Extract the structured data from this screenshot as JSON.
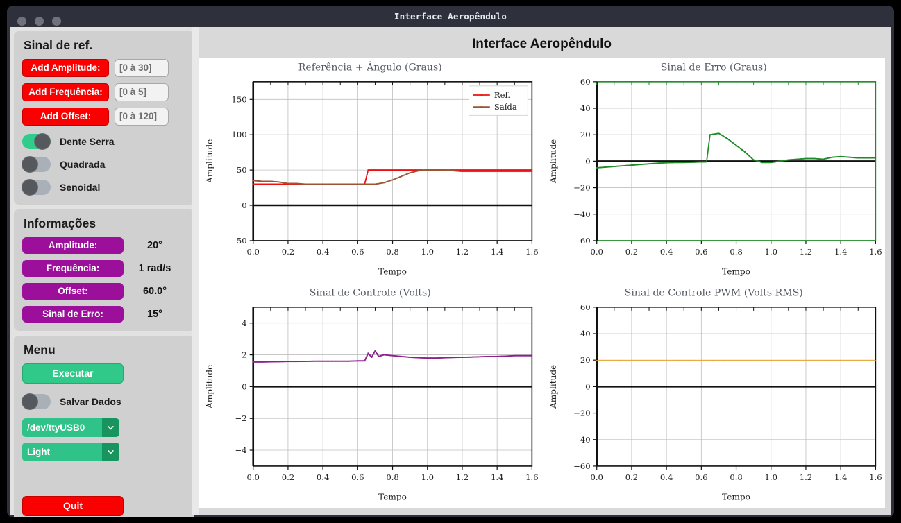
{
  "titlebar": {
    "title": "Interface Aeropêndulo"
  },
  "header": {
    "title": "Interface Aeropêndulo"
  },
  "sidebar": {
    "signal_panel": {
      "title": "Sinal de ref.",
      "inputs": [
        {
          "button": "Add Amplitude:",
          "placeholder": "[0 à 30]"
        },
        {
          "button": "Add Frequência:",
          "placeholder": "[0 à 5]"
        },
        {
          "button": "Add Offset:",
          "placeholder": "[0 à 120]"
        }
      ],
      "toggles": [
        {
          "label": "Dente Serra",
          "state": "on"
        },
        {
          "label": "Quadrada",
          "state": "off"
        },
        {
          "label": "Senoidal",
          "state": "off"
        }
      ]
    },
    "info_panel": {
      "title": "Informações",
      "rows": [
        {
          "label": "Amplitude:",
          "value": "20°"
        },
        {
          "label": "Frequência:",
          "value": "1 rad/s"
        },
        {
          "label": "Offset:",
          "value": "60.0°"
        },
        {
          "label": "Sinal de Erro:",
          "value": "15°"
        }
      ]
    },
    "menu_panel": {
      "title": "Menu",
      "run_label": "Executar",
      "save_toggle": {
        "label": "Salvar Dados",
        "state": "off"
      },
      "port_select": {
        "value": "/dev/ttyUSB0"
      },
      "theme_select": {
        "value": "Light"
      },
      "quit_label": "Quit"
    }
  },
  "colors": {
    "red": "#fa0000",
    "purple": "#9b0f9b",
    "green": "#31c98a",
    "toggle_on": "#2fcc8b",
    "ref_line": "#ee1111",
    "saida_line": "#9c5434",
    "erro_line": "#1d8b28",
    "controle_line": "#8e2090",
    "pwm_line": "#f2a621"
  },
  "chart_data": [
    {
      "type": "line",
      "title": "Referência + Ângulo (Graus)",
      "xlabel": "Tempo",
      "ylabel": "Amplitude",
      "xlim": [
        0.0,
        1.6
      ],
      "ylim": [
        -50,
        175
      ],
      "xticks": [
        "0.0",
        "0.2",
        "0.4",
        "0.6",
        "0.8",
        "1.0",
        "1.2",
        "1.4",
        "1.6"
      ],
      "yticks": [
        "−50",
        "0",
        "50",
        "100",
        "150"
      ],
      "ytick_values": [
        -50,
        0,
        50,
        100,
        150
      ],
      "grid": true,
      "legend": [
        "Ref.",
        "Saída"
      ],
      "legend_position": "upper right",
      "x": [
        0.0,
        0.05,
        0.1,
        0.15,
        0.2,
        0.25,
        0.3,
        0.35,
        0.4,
        0.45,
        0.5,
        0.55,
        0.6,
        0.64,
        0.66,
        0.7,
        0.75,
        0.8,
        0.85,
        0.9,
        0.95,
        1.0,
        1.05,
        1.1,
        1.15,
        1.2,
        1.25,
        1.3,
        1.35,
        1.4,
        1.45,
        1.5,
        1.55,
        1.6
      ],
      "series": [
        {
          "name": "Ref.",
          "color": "#ee1111",
          "values": [
            30,
            30,
            30,
            30,
            30,
            30,
            30,
            30,
            30,
            30,
            30,
            30,
            30,
            30,
            50,
            50,
            50,
            50,
            50,
            50,
            50,
            50,
            50,
            50,
            50,
            50,
            50,
            50,
            50,
            50,
            50,
            50,
            50,
            50
          ]
        },
        {
          "name": "Saída",
          "color": "#9c5434",
          "values": [
            35,
            34,
            34,
            33,
            31,
            31,
            30,
            30,
            30,
            30,
            30,
            30,
            30,
            30,
            30,
            30,
            32,
            36,
            41,
            46,
            49,
            50,
            50,
            50,
            49,
            48,
            48,
            48,
            48,
            48,
            48,
            48,
            48,
            48
          ]
        }
      ]
    },
    {
      "type": "line",
      "title": "Sinal de Erro (Graus)",
      "xlabel": "Tempo",
      "ylabel": "Amplitude",
      "xlim": [
        0.0,
        1.6
      ],
      "ylim": [
        -60,
        60
      ],
      "xticks": [
        "0.0",
        "0.2",
        "0.4",
        "0.6",
        "0.8",
        "1.0",
        "1.2",
        "1.4",
        "1.6"
      ],
      "yticks": [
        "−60",
        "−40",
        "−20",
        "0",
        "20",
        "40",
        "60"
      ],
      "ytick_values": [
        -60,
        -40,
        -20,
        0,
        20,
        40,
        60
      ],
      "grid": true,
      "spine_color": "#1d8b28",
      "x": [
        0.0,
        0.05,
        0.1,
        0.15,
        0.2,
        0.25,
        0.3,
        0.35,
        0.4,
        0.45,
        0.5,
        0.55,
        0.6,
        0.63,
        0.65,
        0.7,
        0.75,
        0.8,
        0.85,
        0.9,
        0.95,
        1.0,
        1.05,
        1.1,
        1.15,
        1.2,
        1.25,
        1.3,
        1.35,
        1.4,
        1.45,
        1.5,
        1.55,
        1.6
      ],
      "series": [
        {
          "name": "Erro",
          "color": "#1d8b28",
          "values": [
            -5,
            -4.5,
            -4,
            -3.5,
            -3,
            -2.5,
            -2,
            -1.5,
            -1.2,
            -1,
            -1,
            -0.8,
            -0.6,
            -0.5,
            20,
            21,
            17,
            12,
            7,
            1,
            -1,
            -1,
            0,
            1,
            1.5,
            2,
            2,
            1.5,
            3,
            3.5,
            3,
            2.5,
            2.5,
            2.5
          ]
        }
      ]
    },
    {
      "type": "line",
      "title": "Sinal de Controle (Volts)",
      "xlabel": "Tempo",
      "ylabel": "Amplitude",
      "xlim": [
        0.0,
        1.6
      ],
      "ylim": [
        -5,
        5
      ],
      "xticks": [
        "0.0",
        "0.2",
        "0.4",
        "0.6",
        "0.8",
        "1.0",
        "1.2",
        "1.4",
        "1.6"
      ],
      "yticks": [
        "−4",
        "−2",
        "0",
        "2",
        "4"
      ],
      "ytick_values": [
        -4,
        -2,
        0,
        2,
        4
      ],
      "grid": true,
      "x": [
        0.0,
        0.05,
        0.1,
        0.15,
        0.2,
        0.25,
        0.3,
        0.35,
        0.4,
        0.45,
        0.5,
        0.55,
        0.6,
        0.64,
        0.66,
        0.68,
        0.7,
        0.72,
        0.75,
        0.8,
        0.85,
        0.9,
        0.95,
        1.0,
        1.05,
        1.1,
        1.15,
        1.2,
        1.25,
        1.3,
        1.35,
        1.4,
        1.45,
        1.5,
        1.55,
        1.6
      ],
      "series": [
        {
          "name": "Controle",
          "color": "#8e2090",
          "values": [
            1.55,
            1.55,
            1.56,
            1.57,
            1.58,
            1.58,
            1.59,
            1.6,
            1.6,
            1.6,
            1.6,
            1.6,
            1.62,
            1.62,
            2.1,
            1.85,
            2.25,
            1.9,
            2.0,
            1.95,
            1.9,
            1.85,
            1.82,
            1.8,
            1.8,
            1.82,
            1.84,
            1.85,
            1.86,
            1.88,
            1.9,
            1.9,
            1.92,
            1.95,
            1.95,
            1.95
          ]
        }
      ]
    },
    {
      "type": "line",
      "title": "Sinal de Controle PWM (Volts RMS)",
      "xlabel": "Tempo",
      "ylabel": "Amplitude",
      "xlim": [
        0.0,
        1.6
      ],
      "ylim": [
        -60,
        60
      ],
      "xticks": [
        "0.0",
        "0.2",
        "0.4",
        "0.6",
        "0.8",
        "1.0",
        "1.2",
        "1.4",
        "1.6"
      ],
      "yticks": [
        "−60",
        "−40",
        "−20",
        "0",
        "20",
        "40",
        "60"
      ],
      "ytick_values": [
        -60,
        -40,
        -20,
        0,
        20,
        40,
        60
      ],
      "grid": true,
      "x": [
        0.0,
        0.4,
        0.8,
        1.2,
        1.6
      ],
      "series": [
        {
          "name": "PWM",
          "color": "#f2a621",
          "values": [
            19.5,
            19.5,
            19.5,
            19.5,
            19.5
          ]
        }
      ]
    }
  ]
}
